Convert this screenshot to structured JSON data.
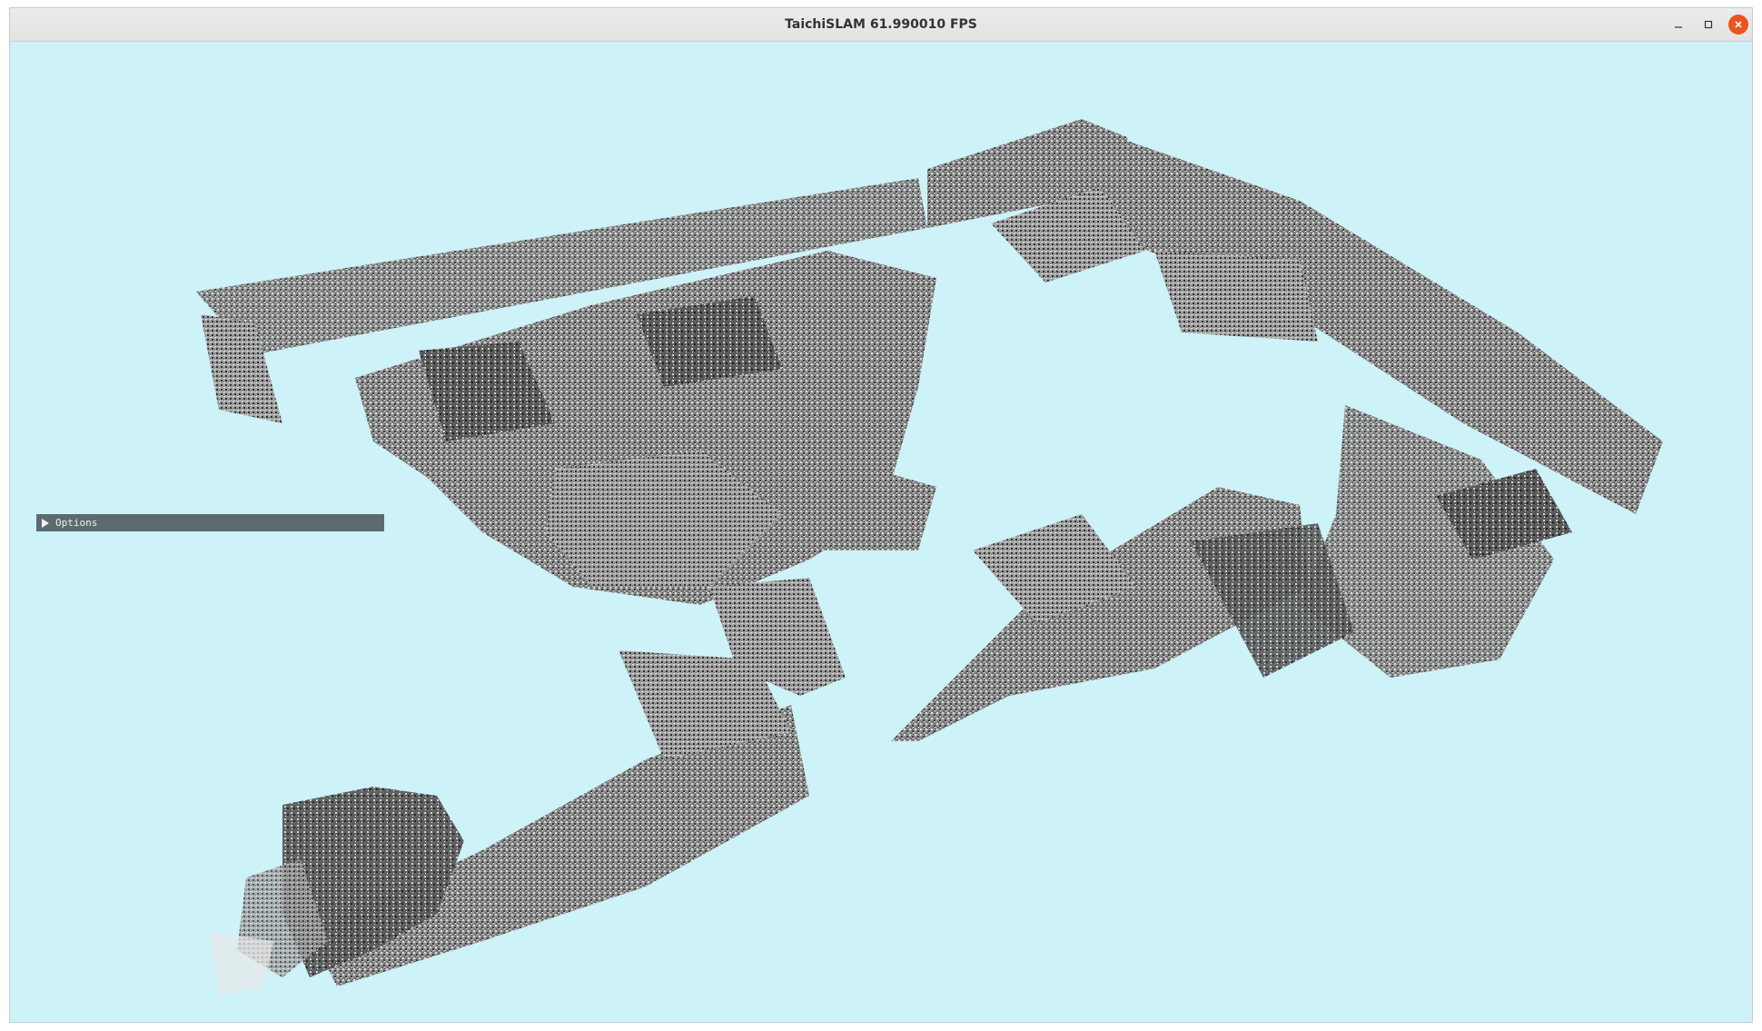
{
  "window": {
    "title": "TaichiSLAM  61.990010 FPS",
    "controls": [
      "minimize-icon",
      "maximize-icon",
      "close-icon"
    ],
    "close_color": "#e95420"
  },
  "viewport": {
    "background_color": "#cdf2f8",
    "content": "point-cloud-map"
  },
  "options": {
    "label": "Options",
    "collapsed": true,
    "icon": "triangle-right-icon"
  }
}
